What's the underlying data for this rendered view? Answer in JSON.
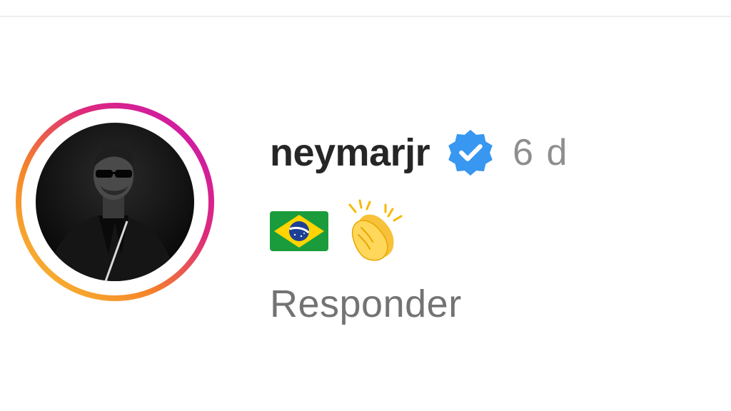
{
  "comment": {
    "username": "neymarjr",
    "verified": true,
    "time": "6 d",
    "emojis": [
      "brazil-flag-icon",
      "clapping-hands-icon"
    ],
    "reply_label": "Responder"
  },
  "colors": {
    "username": "#262626",
    "time": "#8e8e8e",
    "reply": "#737373",
    "verified_badge": "#3897f0",
    "story_ring_start": "#f9c335",
    "story_ring_end": "#c913b9"
  }
}
